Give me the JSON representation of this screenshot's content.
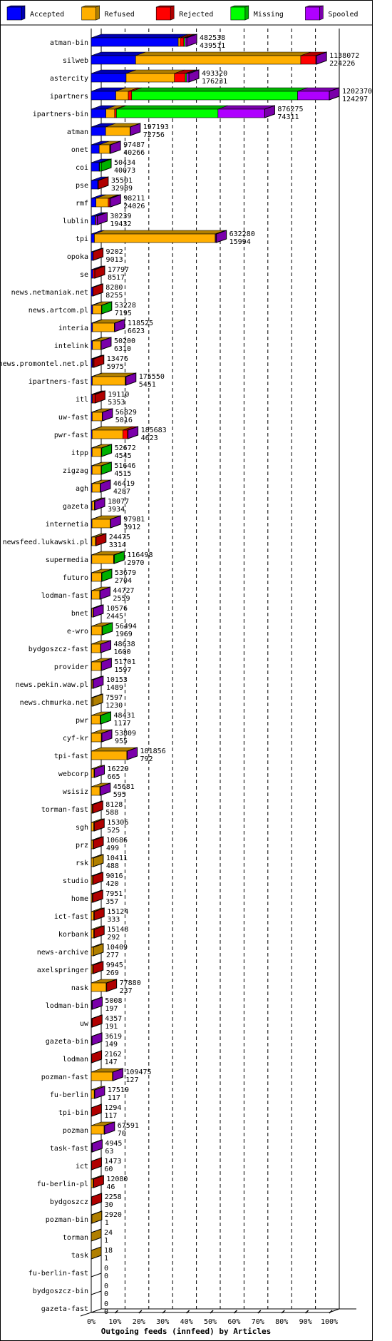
{
  "chart_data": {
    "type": "bar",
    "orientation": "horizontal",
    "stacked": true,
    "title": "Outgoing feeds (innfeed) by Articles",
    "legend_position": "top",
    "legend": [
      "Accepted",
      "Refused",
      "Rejected",
      "Missing",
      "Spooled"
    ],
    "series_keys": [
      "accepted",
      "refused",
      "rejected",
      "missing",
      "spooled"
    ],
    "colors": {
      "accepted": "#0000ff",
      "refused": "#ffaf00",
      "rejected": "#ff0000",
      "missing": "#00ff00",
      "spooled": "#af00ff"
    },
    "dark_colors": {
      "accepted": "#0000b0",
      "refused": "#b07f00",
      "rejected": "#b00000",
      "missing": "#00b000",
      "spooled": "#7a00aa"
    },
    "x_ticks": [
      "0%",
      "10%",
      "20%",
      "30%",
      "40%",
      "50%",
      "60%",
      "70%",
      "80%",
      "90%",
      "100%"
    ],
    "xlim": [
      0,
      100
    ],
    "grid": true,
    "rows": [
      {
        "name": "atman-bin",
        "total": 482538,
        "accepted": 439511,
        "refused": 10000,
        "rejected": 18000,
        "missing": 7000,
        "spooled": 8027
      },
      {
        "name": "silweb",
        "total": 1138072,
        "accepted": 224226,
        "refused": 834000,
        "rejected": 76000,
        "missing": 0,
        "spooled": 3846
      },
      {
        "name": "astercity",
        "total": 493320,
        "accepted": 176231,
        "refused": 244000,
        "rejected": 55000,
        "missing": 7000,
        "spooled": 11089
      },
      {
        "name": "ipartners",
        "total": 1202370,
        "accepted": 124297,
        "refused": 63000,
        "rejected": 17000,
        "missing": 838000,
        "spooled": 160073
      },
      {
        "name": "ipartners-bin",
        "total": 876275,
        "accepted": 74311,
        "refused": 44000,
        "rejected": 9000,
        "missing": 513000,
        "spooled": 235964
      },
      {
        "name": "atman",
        "total": 197193,
        "accepted": 72756,
        "refused": 123000,
        "rejected": 0,
        "missing": 0,
        "spooled": 1437
      },
      {
        "name": "onet",
        "total": 97487,
        "accepted": 40266,
        "refused": 53000,
        "rejected": 1000,
        "missing": 0,
        "spooled": 3221
      },
      {
        "name": "coi",
        "total": 50434,
        "accepted": 40073,
        "refused": 2000,
        "rejected": 0,
        "missing": 8361,
        "spooled": 0
      },
      {
        "name": "pse",
        "total": 35501,
        "accepted": 32989,
        "refused": 0,
        "rejected": 2512,
        "missing": 0,
        "spooled": 0
      },
      {
        "name": "rmf",
        "total": 98211,
        "accepted": 24026,
        "refused": 62000,
        "rejected": 7000,
        "missing": 0,
        "spooled": 5185
      },
      {
        "name": "lublin",
        "total": 30239,
        "accepted": 19432,
        "refused": 4000,
        "rejected": 0,
        "missing": 0,
        "spooled": 6807
      },
      {
        "name": "tpi",
        "total": 632280,
        "accepted": 15994,
        "refused": 610000,
        "rejected": 2000,
        "missing": 0,
        "spooled": 4286
      },
      {
        "name": "opoka",
        "total": 9202,
        "accepted": 9013,
        "refused": 0,
        "rejected": 189,
        "missing": 0,
        "spooled": 0
      },
      {
        "name": "se",
        "total": 17797,
        "accepted": 8517,
        "refused": 0,
        "rejected": 9280,
        "missing": 0,
        "spooled": 0
      },
      {
        "name": "news.netmaniak.net",
        "total": 8280,
        "accepted": 8255,
        "refused": 0,
        "rejected": 25,
        "missing": 0,
        "spooled": 0
      },
      {
        "name": "news.artcom.pl",
        "total": 53228,
        "accepted": 7195,
        "refused": 44000,
        "rejected": 0,
        "missing": 2033,
        "spooled": 0
      },
      {
        "name": "interia",
        "total": 118525,
        "accepted": 6623,
        "refused": 110000,
        "rejected": 0,
        "missing": 0,
        "spooled": 1902
      },
      {
        "name": "intelink",
        "total": 50200,
        "accepted": 6310,
        "refused": 42000,
        "rejected": 0,
        "missing": 0,
        "spooled": 1890
      },
      {
        "name": "news.promontel.net.pl",
        "total": 13476,
        "accepted": 5975,
        "refused": 2000,
        "rejected": 5501,
        "missing": 0,
        "spooled": 0
      },
      {
        "name": "ipartners-fast",
        "total": 175550,
        "accepted": 5451,
        "refused": 166000,
        "rejected": 2000,
        "missing": 0,
        "spooled": 2099
      },
      {
        "name": "itl",
        "total": 19110,
        "accepted": 5353,
        "refused": 4000,
        "rejected": 9757,
        "missing": 0,
        "spooled": 0
      },
      {
        "name": "uw-fast",
        "total": 56829,
        "accepted": 5016,
        "refused": 50000,
        "rejected": 0,
        "missing": 0,
        "spooled": 1813
      },
      {
        "name": "pwr-fast",
        "total": 185683,
        "accepted": 4623,
        "refused": 155000,
        "rejected": 24000,
        "missing": 0,
        "spooled": 2060
      },
      {
        "name": "itpp",
        "total": 52672,
        "accepted": 4545,
        "refused": 46000,
        "rejected": 0,
        "missing": 2127,
        "spooled": 0
      },
      {
        "name": "zigzag",
        "total": 51646,
        "accepted": 4515,
        "refused": 45000,
        "rejected": 0,
        "missing": 2131,
        "spooled": 0
      },
      {
        "name": "agh",
        "total": 46419,
        "accepted": 4287,
        "refused": 40000,
        "rejected": 0,
        "missing": 0,
        "spooled": 2132
      },
      {
        "name": "gazeta",
        "total": 18077,
        "accepted": 3934,
        "refused": 12000,
        "rejected": 0,
        "missing": 0,
        "spooled": 2143
      },
      {
        "name": "internetia",
        "total": 97981,
        "accepted": 3912,
        "refused": 92000,
        "rejected": 0,
        "missing": 0,
        "spooled": 2069
      },
      {
        "name": "newsfeed.lukawski.pl",
        "total": 24475,
        "accepted": 3314,
        "refused": 18000,
        "rejected": 3161,
        "missing": 0,
        "spooled": 0
      },
      {
        "name": "supermedia",
        "total": 116498,
        "accepted": 2970,
        "refused": 110000,
        "rejected": 1000,
        "missing": 2528,
        "spooled": 0
      },
      {
        "name": "futuro",
        "total": 53679,
        "accepted": 2704,
        "refused": 49000,
        "rejected": 0,
        "missing": 1975,
        "spooled": 0
      },
      {
        "name": "lodman-fast",
        "total": 44727,
        "accepted": 2559,
        "refused": 40000,
        "rejected": 0,
        "missing": 0,
        "spooled": 2168
      },
      {
        "name": "bnet",
        "total": 10576,
        "accepted": 2445,
        "refused": 6000,
        "rejected": 0,
        "missing": 0,
        "spooled": 2131
      },
      {
        "name": "e-wro",
        "total": 56494,
        "accepted": 1969,
        "refused": 52000,
        "rejected": 0,
        "missing": 2525,
        "spooled": 0
      },
      {
        "name": "bydgoszcz-fast",
        "total": 48638,
        "accepted": 1600,
        "refused": 45000,
        "rejected": 0,
        "missing": 0,
        "spooled": 2038
      },
      {
        "name": "provider",
        "total": 51701,
        "accepted": 1597,
        "refused": 48000,
        "rejected": 0,
        "missing": 0,
        "spooled": 2104
      },
      {
        "name": "news.pekin.waw.pl",
        "total": 10153,
        "accepted": 1489,
        "refused": 6000,
        "rejected": 0,
        "missing": 0,
        "spooled": 2664
      },
      {
        "name": "news.chmurka.net",
        "total": 7597,
        "accepted": 1230,
        "refused": 6367,
        "rejected": 0,
        "missing": 0,
        "spooled": 0
      },
      {
        "name": "pwr",
        "total": 48431,
        "accepted": 1177,
        "refused": 44000,
        "rejected": 1000,
        "missing": 2254,
        "spooled": 0
      },
      {
        "name": "cyf-kr",
        "total": 53809,
        "accepted": 955,
        "refused": 50000,
        "rejected": 0,
        "missing": 0,
        "spooled": 2854
      },
      {
        "name": "tpi-fast",
        "total": 181856,
        "accepted": 792,
        "refused": 179000,
        "rejected": 0,
        "missing": 0,
        "spooled": 2064
      },
      {
        "name": "webcorp",
        "total": 16229,
        "accepted": 665,
        "refused": 13000,
        "rejected": 0,
        "missing": 0,
        "spooled": 2564
      },
      {
        "name": "wsisiz",
        "total": 45681,
        "accepted": 595,
        "refused": 43000,
        "rejected": 0,
        "missing": 0,
        "spooled": 2086
      },
      {
        "name": "torman-fast",
        "total": 8128,
        "accepted": 588,
        "refused": 5000,
        "rejected": 2540,
        "missing": 0,
        "spooled": 0
      },
      {
        "name": "sgh",
        "total": 15306,
        "accepted": 525,
        "refused": 12000,
        "rejected": 2781,
        "missing": 0,
        "spooled": 0
      },
      {
        "name": "prz",
        "total": 10686,
        "accepted": 499,
        "refused": 8000,
        "rejected": 2187,
        "missing": 0,
        "spooled": 0
      },
      {
        "name": "rsk",
        "total": 10411,
        "accepted": 488,
        "refused": 9923,
        "rejected": 0,
        "missing": 0,
        "spooled": 0
      },
      {
        "name": "studio",
        "total": 9016,
        "accepted": 420,
        "refused": 6000,
        "rejected": 2596,
        "missing": 0,
        "spooled": 0
      },
      {
        "name": "home",
        "total": 7951,
        "accepted": 357,
        "refused": 5000,
        "rejected": 2594,
        "missing": 0,
        "spooled": 0
      },
      {
        "name": "ict-fast",
        "total": 15124,
        "accepted": 333,
        "refused": 12000,
        "rejected": 2791,
        "missing": 0,
        "spooled": 0
      },
      {
        "name": "korbank",
        "total": 15148,
        "accepted": 292,
        "refused": 12000,
        "rejected": 2856,
        "missing": 0,
        "spooled": 0
      },
      {
        "name": "news-archive",
        "total": 10409,
        "accepted": 277,
        "refused": 10132,
        "rejected": 0,
        "missing": 0,
        "spooled": 0
      },
      {
        "name": "axelspringer",
        "total": 9945,
        "accepted": 269,
        "refused": 7000,
        "rejected": 2676,
        "missing": 0,
        "spooled": 0
      },
      {
        "name": "nask",
        "total": 77880,
        "accepted": 237,
        "refused": 75000,
        "rejected": 2643,
        "missing": 0,
        "spooled": 0
      },
      {
        "name": "lodman-bin",
        "total": 5008,
        "accepted": 197,
        "refused": 2000,
        "rejected": 0,
        "missing": 0,
        "spooled": 2811
      },
      {
        "name": "uw",
        "total": 4357,
        "accepted": 191,
        "refused": 2000,
        "rejected": 2166,
        "missing": 0,
        "spooled": 0
      },
      {
        "name": "gazeta-bin",
        "total": 3619,
        "accepted": 149,
        "refused": 1000,
        "rejected": 0,
        "missing": 0,
        "spooled": 2470
      },
      {
        "name": "lodman",
        "total": 2162,
        "accepted": 147,
        "refused": 0,
        "rejected": 2015,
        "missing": 0,
        "spooled": 0
      },
      {
        "name": "pozman-fast",
        "total": 109475,
        "accepted": 127,
        "refused": 107000,
        "rejected": 0,
        "missing": 0,
        "spooled": 2348
      },
      {
        "name": "fu-berlin",
        "total": 17519,
        "accepted": 117,
        "refused": 15000,
        "rejected": 0,
        "missing": 0,
        "spooled": 2402
      },
      {
        "name": "tpi-bin",
        "total": 1294,
        "accepted": 117,
        "refused": 0,
        "rejected": 1177,
        "missing": 0,
        "spooled": 0
      },
      {
        "name": "pozman",
        "total": 67591,
        "accepted": 70,
        "refused": 65000,
        "rejected": 0,
        "missing": 0,
        "spooled": 2521
      },
      {
        "name": "task-fast",
        "total": 4945,
        "accepted": 63,
        "refused": 2000,
        "rejected": 0,
        "missing": 0,
        "spooled": 2882
      },
      {
        "name": "ict",
        "total": 1473,
        "accepted": 60,
        "refused": 0,
        "rejected": 1413,
        "missing": 0,
        "spooled": 0
      },
      {
        "name": "fu-berlin-pl",
        "total": 12080,
        "accepted": 46,
        "refused": 9000,
        "rejected": 3034,
        "missing": 0,
        "spooled": 0
      },
      {
        "name": "bydgoszcz",
        "total": 2258,
        "accepted": 30,
        "refused": 0,
        "rejected": 2228,
        "missing": 0,
        "spooled": 0
      },
      {
        "name": "pozman-bin",
        "total": 2920,
        "accepted": 1,
        "refused": 2919,
        "rejected": 0,
        "missing": 0,
        "spooled": 0
      },
      {
        "name": "torman",
        "total": 24,
        "accepted": 1,
        "refused": 23,
        "rejected": 0,
        "missing": 0,
        "spooled": 0
      },
      {
        "name": "task",
        "total": 18,
        "accepted": 1,
        "refused": 17,
        "rejected": 0,
        "missing": 0,
        "spooled": 0
      },
      {
        "name": "fu-berlin-fast",
        "total": 0,
        "accepted": 0,
        "refused": 0,
        "rejected": 0,
        "missing": 0,
        "spooled": 0
      },
      {
        "name": "bydgoszcz-bin",
        "total": 0,
        "accepted": 0,
        "refused": 0,
        "rejected": 0,
        "missing": 0,
        "spooled": 0
      },
      {
        "name": "gazeta-fast",
        "total": 0,
        "accepted": 0,
        "refused": 0,
        "rejected": 0,
        "missing": 0,
        "spooled": 0
      }
    ]
  }
}
